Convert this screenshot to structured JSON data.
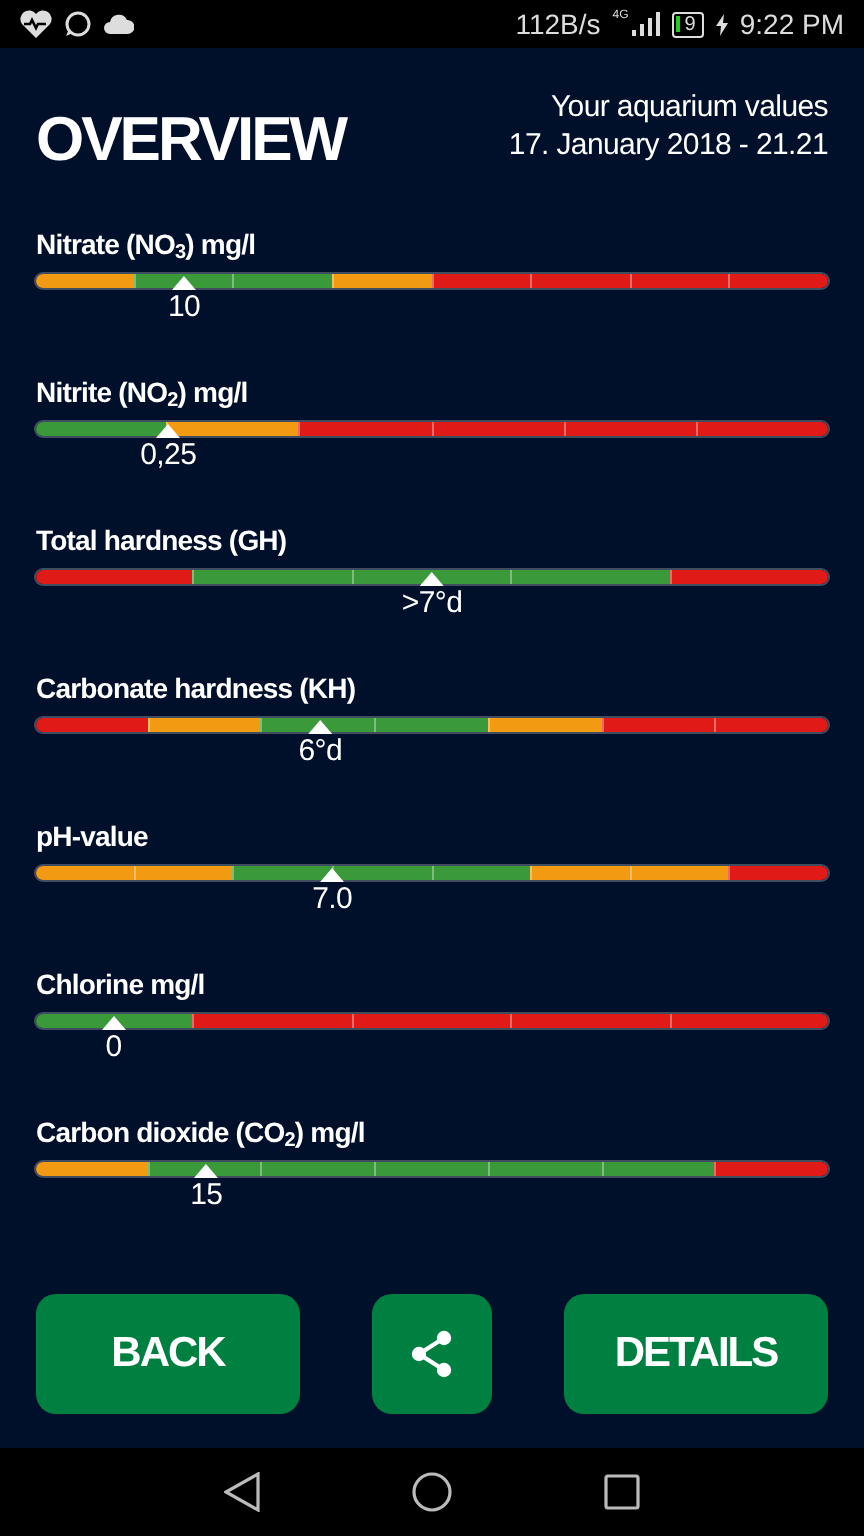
{
  "status_bar": {
    "network_speed": "112B/s",
    "network_type": "4G",
    "battery": "9",
    "time": "9:22 PM"
  },
  "header": {
    "title": "OVERVIEW",
    "subtitle": "Your aquarium values",
    "date": "17. January 2018 - 21.21"
  },
  "gauges": [
    {
      "label": "Nitrate (NO$_{3}$) mg/l",
      "value": "10",
      "level": 0.187,
      "segments": [
        {
          "color": "#f29a12"
        },
        {
          "color": "#3a9a3a"
        },
        {
          "color": "#3a9a3a"
        },
        {
          "color": "#f29a12"
        },
        {
          "color": "#e01a16"
        },
        {
          "color": "#e01a16"
        },
        {
          "color": "#e01a16"
        },
        {
          "color": "#e01a16"
        }
      ]
    },
    {
      "label": "Nitrite (NO$_{2}$) mg/l",
      "value": "0,25",
      "level": 0.167,
      "segments": [
        {
          "color": "#3a9a3a"
        },
        {
          "color": "#f29a12"
        },
        {
          "color": "#e01a16"
        },
        {
          "color": "#e01a16"
        },
        {
          "color": "#e01a16"
        },
        {
          "color": "#e01a16"
        }
      ]
    },
    {
      "label": "Total hardness (GH)",
      "value": ">7°d",
      "level": 0.5,
      "segments": [
        {
          "color": "#e01a16"
        },
        {
          "color": "#3a9a3a"
        },
        {
          "color": "#3a9a3a"
        },
        {
          "color": "#3a9a3a"
        },
        {
          "color": "#e01a16"
        }
      ]
    },
    {
      "label": "Carbonate hardness (KH)",
      "value": "6°d",
      "level": 0.359,
      "segments": [
        {
          "color": "#e01a16"
        },
        {
          "color": "#f29a12"
        },
        {
          "color": "#3a9a3a"
        },
        {
          "color": "#3a9a3a"
        },
        {
          "color": "#f29a12"
        },
        {
          "color": "#e01a16"
        },
        {
          "color": "#e01a16"
        }
      ]
    },
    {
      "label": "pH-value",
      "value": "7.0",
      "level": 0.374,
      "segments": [
        {
          "color": "#f29a12"
        },
        {
          "color": "#f29a12"
        },
        {
          "color": "#3a9a3a"
        },
        {
          "color": "#3a9a3a"
        },
        {
          "color": "#3a9a3a"
        },
        {
          "color": "#f29a12"
        },
        {
          "color": "#f29a12"
        },
        {
          "color": "#e01a16"
        }
      ]
    },
    {
      "label": "Chlorine mg/l",
      "value": "0",
      "level": 0.098,
      "segments": [
        {
          "color": "#3a9a3a"
        },
        {
          "color": "#e01a16"
        },
        {
          "color": "#e01a16"
        },
        {
          "color": "#e01a16"
        },
        {
          "color": "#e01a16"
        }
      ]
    },
    {
      "label": "Carbon dioxide (CO$_{2}$) mg/l",
      "value": "15",
      "level": 0.215,
      "segments": [
        {
          "color": "#f29a12"
        },
        {
          "color": "#3a9a3a"
        },
        {
          "color": "#3a9a3a"
        },
        {
          "color": "#3a9a3a"
        },
        {
          "color": "#3a9a3a"
        },
        {
          "color": "#3a9a3a"
        },
        {
          "color": "#e01a16"
        }
      ]
    }
  ],
  "buttons": [
    {
      "kind": "text",
      "label": "BACK"
    },
    {
      "kind": "share"
    },
    {
      "kind": "text",
      "label": "DETAILS"
    }
  ]
}
